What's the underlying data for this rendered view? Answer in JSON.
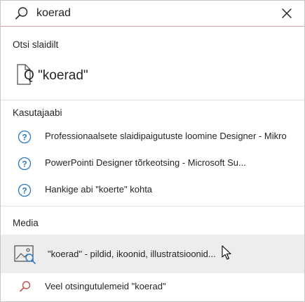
{
  "search": {
    "query": "koerad",
    "icon": "search-icon",
    "clear_icon": "close-icon"
  },
  "sections": {
    "slides": {
      "title": "Otsi slaidilt",
      "item_label": "\"koerad\"",
      "icon": "find-in-document-icon"
    },
    "help": {
      "title": "Kasutajaabi",
      "items": [
        {
          "label": "Professionaalsete slaidipaigutuste loomine Designer - Mikro",
          "icon": "help-icon"
        },
        {
          "label": "PowerPointi Designer tõrkeotsing - Microsoft Su...",
          "icon": "help-icon"
        },
        {
          "label": "Hankige abi \"koerte\" kohta",
          "icon": "help-icon"
        }
      ]
    },
    "media": {
      "title": "Media",
      "item_label": "\"koerad\" - pildid, ikoonid, illustratsioonid...",
      "icon": "image-search-icon"
    },
    "more": {
      "label": "Veel otsingutulemeid \"koerad\"",
      "icon": "search-icon"
    }
  },
  "colors": {
    "accent": "#c0504d",
    "help_icon": "#2b78c2",
    "more_search_icon": "#c0504d",
    "hover_bg": "#ededed"
  }
}
